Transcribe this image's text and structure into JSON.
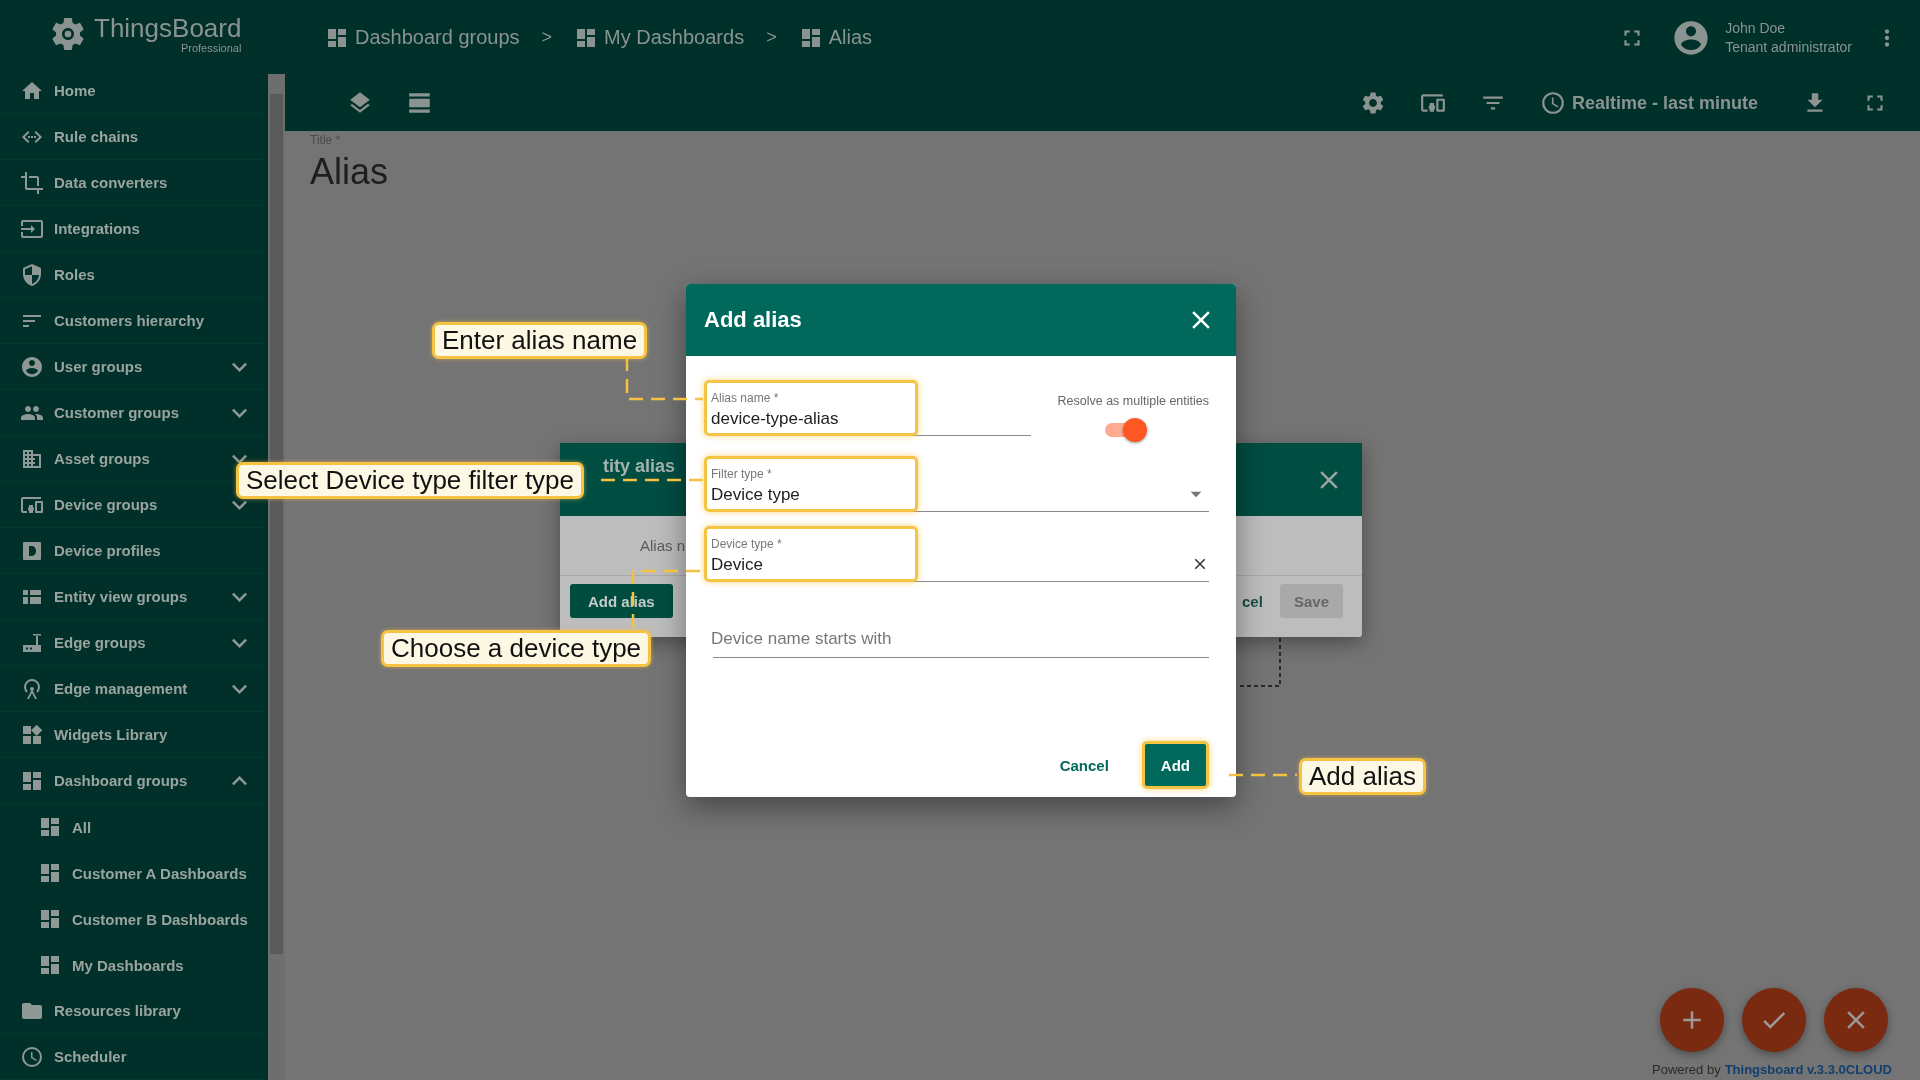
{
  "app": {
    "logo": "ThingsBoard",
    "edition": "Professional"
  },
  "sidebar": {
    "items": [
      {
        "label": "Home"
      },
      {
        "label": "Rule chains"
      },
      {
        "label": "Data converters"
      },
      {
        "label": "Integrations"
      },
      {
        "label": "Roles"
      },
      {
        "label": "Customers hierarchy"
      },
      {
        "label": "User groups",
        "expanded": false
      },
      {
        "label": "Customer groups",
        "expanded": false
      },
      {
        "label": "Asset groups",
        "expanded": false
      },
      {
        "label": "Device groups",
        "expanded": false
      },
      {
        "label": "Device profiles"
      },
      {
        "label": "Entity view groups",
        "expanded": false
      },
      {
        "label": "Edge groups",
        "expanded": false
      },
      {
        "label": "Edge management",
        "expanded": false
      },
      {
        "label": "Widgets Library"
      },
      {
        "label": "Dashboard groups",
        "expanded": true,
        "children": [
          {
            "label": "All"
          },
          {
            "label": "Customer A Dashboards"
          },
          {
            "label": "Customer B Dashboards"
          },
          {
            "label": "My Dashboards"
          }
        ]
      },
      {
        "label": "Resources library"
      },
      {
        "label": "Scheduler"
      }
    ]
  },
  "header": {
    "breadcrumbs": [
      {
        "label": "Dashboard groups",
        "separator": ">"
      },
      {
        "label": "My Dashboards",
        "separator": ">"
      },
      {
        "label": "Alias"
      }
    ],
    "user": {
      "name": "John Doe",
      "role": "Tenant administrator"
    },
    "timewindow": "Realtime - last minute"
  },
  "page": {
    "title_label": "Title *",
    "title": "Alias"
  },
  "back_dialog": {
    "title": "tity alias",
    "column_1": "Alias n",
    "buttons": [
      {
        "label": "Add alias",
        "kind": "raised",
        "disabled": false
      },
      {
        "label": "cel",
        "kind": "flat",
        "disabled": false
      },
      {
        "label": "Save",
        "kind": "raised",
        "disabled": true
      }
    ]
  },
  "dialog": {
    "title": "Add alias",
    "fields": [
      {
        "kind": "text",
        "label": "Alias name *",
        "value": "device-type-alias",
        "highlighted": true
      },
      {
        "kind": "select",
        "label": "Filter type *",
        "value": "Device type",
        "highlighted": true
      },
      {
        "kind": "clearable",
        "label": "Device type *",
        "value": "Device",
        "highlighted": true
      },
      {
        "kind": "text",
        "placeholder": "Device name starts with",
        "highlighted": false
      }
    ],
    "toggle": {
      "label": "Resolve as multiple entities",
      "on": true
    },
    "buttons": [
      {
        "label": "Cancel",
        "kind": "flat",
        "highlighted": false
      },
      {
        "label": "Add",
        "kind": "raised",
        "highlighted": true
      }
    ]
  },
  "callouts": [
    {
      "text": "Enter alias name"
    },
    {
      "text": "Select Device type filter type"
    },
    {
      "text": "Choose a device type"
    },
    {
      "text": "Add alias"
    }
  ],
  "footer": {
    "prefix": "Powered by",
    "link": "Thingsboard v.3.3.0CLOUD"
  }
}
